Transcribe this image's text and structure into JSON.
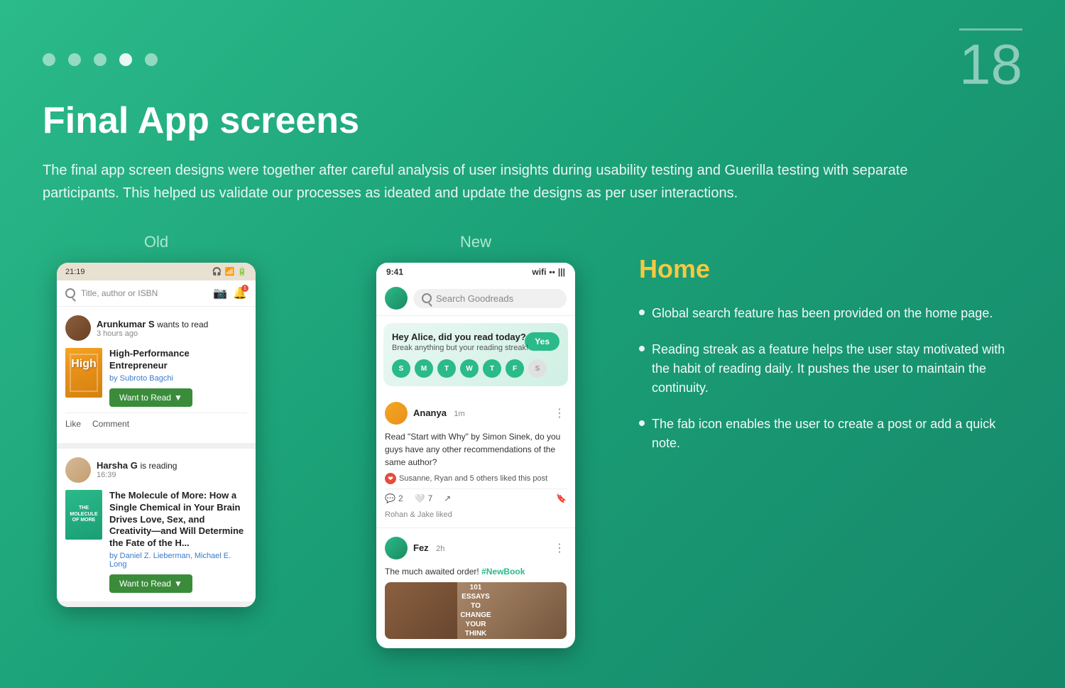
{
  "page": {
    "number": "18",
    "background_color": "#2bba8a"
  },
  "dots": [
    {
      "active": false
    },
    {
      "active": false
    },
    {
      "active": false
    },
    {
      "active": true
    },
    {
      "active": false
    }
  ],
  "title": "Final App screens",
  "description": "The final app screen designs were together after careful analysis of user insights during usability testing and Guerilla testing with separate participants. This helped us validate our processes as ideated and update the designs as per user interactions.",
  "old_label": "Old",
  "new_label": "New",
  "old_phone": {
    "status_time": "21:19",
    "search_placeholder": "Title, author or ISBN",
    "feed_items": [
      {
        "user": "Arunkumar S",
        "action": "wants to read",
        "time": "3 hours ago",
        "book_title": "High-Performance Entrepreneur",
        "author": "by Subroto Bagchi",
        "cta": "Want to Read",
        "high_text": "High"
      },
      {
        "user": "Harsha G",
        "action": "is reading",
        "time": "16:39",
        "book_title": "The Molecule of More: How a Single Chemical in Your Brain Drives Love, Sex, and Creativity—and Will Determine the Fate of the H...",
        "author": "by Daniel Z. Lieberman, Michael E. Long",
        "cta": "Want to Read"
      }
    ],
    "actions": [
      "Like",
      "Comment"
    ]
  },
  "new_phone": {
    "status_time": "9:41",
    "search_placeholder": "Search Goodreads",
    "streak_prompt": "Hey Alice, did you read today?",
    "streak_sub": "Break anything but your reading streak!",
    "yes_btn": "Yes",
    "days": [
      "S",
      "M",
      "T",
      "W",
      "T",
      "F",
      "S"
    ],
    "days_active": [
      true,
      true,
      true,
      true,
      true,
      true,
      false
    ],
    "feed_items": [
      {
        "user": "Ananya",
        "time": "1m",
        "post_text": "Read \"Start with Why\" by Simon Sinek, do you guys have any other recommendations of the same author?",
        "likes_text": "Susanne, Ryan and 5 others liked this post",
        "comments": "2",
        "hearts": "7",
        "liked_by": "Rohan & Jake liked"
      },
      {
        "user": "Fez",
        "time": "2h",
        "post_text": "The much awaited order! #NewBook",
        "book_image_text": "101 ESSAYS CHANGE YOU THINK"
      }
    ]
  },
  "info_panel": {
    "title": "Home",
    "bullets": [
      "Global search feature has been provided on the home page.",
      "Reading streak as a feature helps the user stay motivated with the habit of reading daily. It pushes the user to maintain the continuity.",
      "The fab icon enables the user to create a post or add a quick note."
    ]
  }
}
